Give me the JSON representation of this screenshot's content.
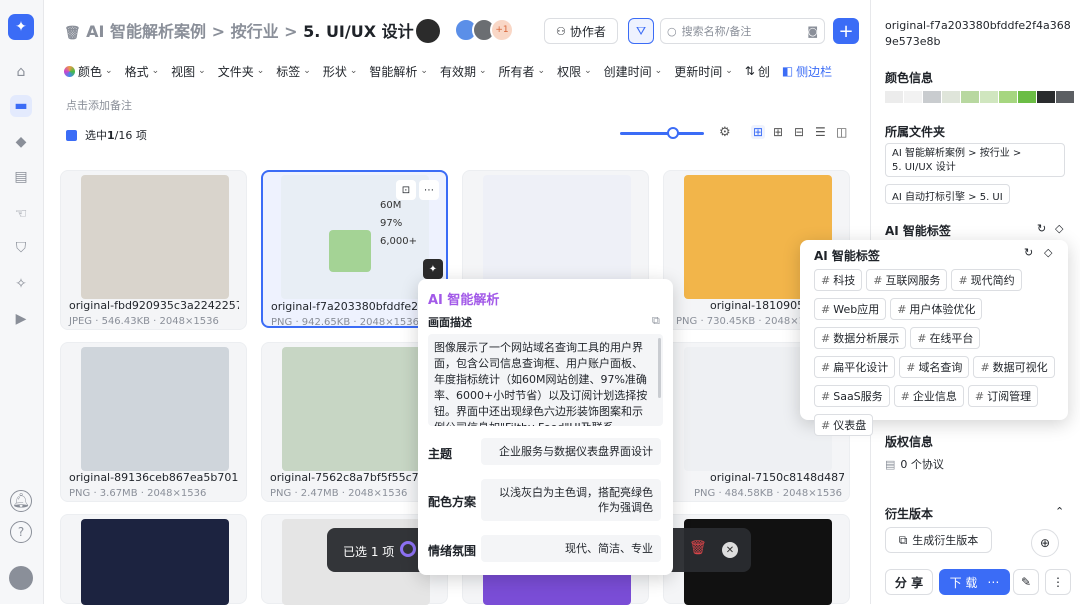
{
  "breadcrumb": {
    "root": "AI 智能解析案例",
    "sep1": ">",
    "mid": "按行业",
    "sep2": ">",
    "current": "5. UI/UX 设计"
  },
  "header": {
    "badge_count": "+1",
    "collab_label": "协作者",
    "search_placeholder": "搜索名称/备注",
    "add_label": "+"
  },
  "filters": [
    "颜色",
    "格式",
    "视图",
    "文件夹",
    "标签",
    "形状",
    "智能解析",
    "有效期",
    "所有者",
    "权限",
    "创建时间",
    "更新时间"
  ],
  "toolbar": {
    "sort_label": "创",
    "sidebar_label": "侧边栏",
    "note_placeholder": "点击添加备注",
    "selected_prefix": "选中 ",
    "selected_count": "1",
    "selected_suffix": "/16 项"
  },
  "grid": [
    {
      "name": "original-fbd920935c3a2242257...",
      "meta": "JPEG · 546.43KB · 2048×1536",
      "color": "#d9d4cc"
    },
    {
      "name": "original-f7a203380bfddfe2f4a",
      "meta": "PNG · 942.65KB · 2048×1536",
      "color": "#e8eef5"
    },
    {
      "name": "",
      "meta": "",
      "color": "#eef0f7"
    },
    {
      "name": "original-181090557a999e",
      "meta": "PNG · 730.45KB · 2048×1536",
      "color": "#f2b54a"
    },
    {
      "name": "original-89136ceb867ea5b7011...",
      "meta": "PNG · 3.67MB · 2048×1536",
      "color": "#cfd5db"
    },
    {
      "name": "original-7562c8a7bf5f55c784",
      "meta": "PNG · 2.47MB · 2048×1536",
      "color": "#c7d6c4"
    },
    {
      "name": "",
      "meta": "",
      "color": "#eef0f3"
    },
    {
      "name": "original-7150c8148d487a8b847...",
      "meta": "PNG · 484.58KB · 2048×1536",
      "color": "#eef0f3"
    },
    {
      "name": "",
      "meta": "",
      "color": "#1c2340"
    },
    {
      "name": "",
      "meta": "",
      "color": "#e5e5e5"
    },
    {
      "name": "",
      "meta": "",
      "color": "#7a4dd6"
    },
    {
      "name": "",
      "meta": "",
      "color": "#111111"
    }
  ],
  "selection_bar": {
    "label": "已选 1 项"
  },
  "ai_popup": {
    "title": "AI 智能解析",
    "desc_label": "画面描述",
    "desc_text": "图像展示了一个网站域名查询工具的用户界面，包含公司信息查询框、用户账户面板、年度指标统计（如60M网站创建、97%准确率、6000+小时节省）以及订阅计划选择按钮。界面中还出现绿色六边形装饰图案和示例公司信息如\"Filthy Food\"UI及联系人\"John",
    "theme_label": "主题",
    "theme_value": "企业服务与数据仪表盘界面设计",
    "color_label": "配色方案",
    "color_value": "以浅灰白为主色调，搭配亮绿色作为强调色",
    "mood_label": "情绪氛围",
    "mood_value": "现代、简洁、专业"
  },
  "tags_popup": {
    "title": "AI 智能标签",
    "tags": [
      "科技",
      "互联网服务",
      "现代简约",
      "Web应用",
      "用户体验优化",
      "数据分析展示",
      "在线平台",
      "扁平化设计",
      "域名查询",
      "数据可视化",
      "SaaS服务",
      "企业信息",
      "订阅管理",
      "仪表盘"
    ]
  },
  "sidebar": {
    "filename": "original-f7a203380bfddfe2f4a3689e573e8b",
    "color_title": "颜色信息",
    "colors": [
      "#ececec",
      "#f2f2f2",
      "#c9cccf",
      "#dfe5da",
      "#b8d8a0",
      "#d0e6bf",
      "#a6d680",
      "#6bbd45",
      "#2a2c2e",
      "#5c5f63"
    ],
    "folder_title": "所属文件夹",
    "folder_path_1": "AI 智能解析案例 > 按行业 >",
    "folder_path_2": "5. UI/UX 设计",
    "folder_path_3": "AI 自动打标引擎 > 5. UI",
    "ai_tags_title": "AI 智能标签",
    "copyright_title": "版权信息",
    "copyright_value": "0 个协议",
    "derive_title": "衍生版本",
    "derive_button": "生成衍生版本",
    "share_label": "分 享",
    "download_label": "下 载"
  }
}
